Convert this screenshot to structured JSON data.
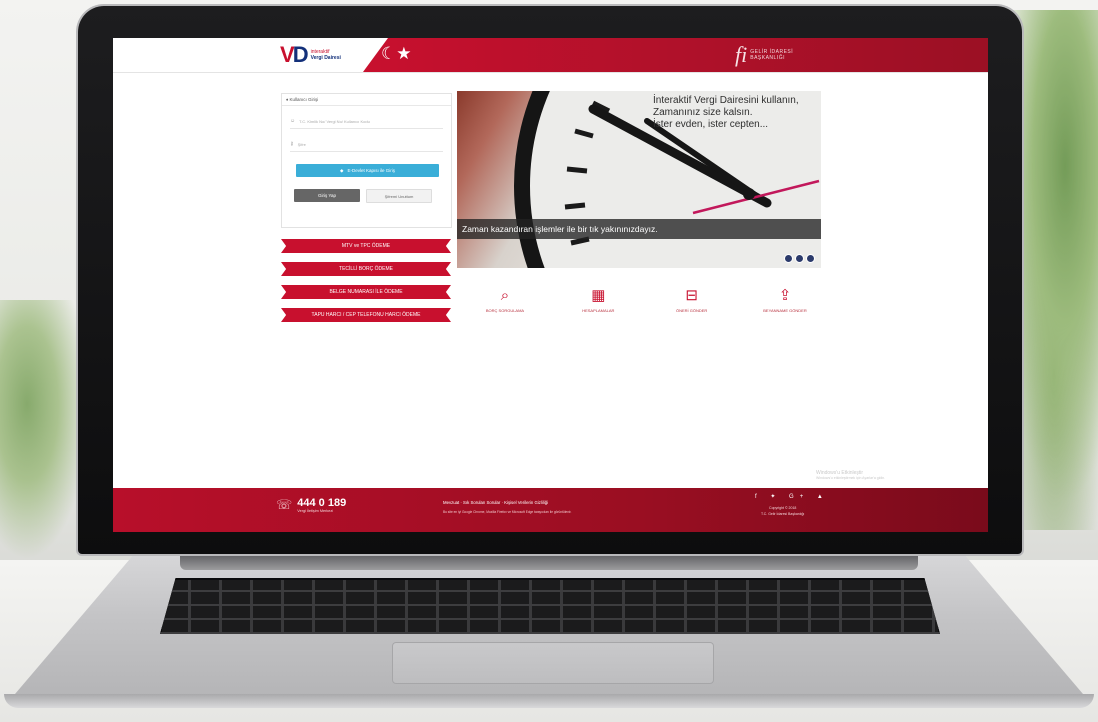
{
  "header": {
    "logo_letters_v": "V",
    "logo_letters_d": "D",
    "logo_line1": "interaktif",
    "logo_line2": "Vergi Dairesi",
    "flag_glyph": "☾★",
    "gib_mark": "fi",
    "gib_line1": "GELİR İDARESİ",
    "gib_line2": "BAŞKANLIĞI"
  },
  "login": {
    "title": "Kullanıcı Girişi",
    "user_placeholder": "T.C. Kimlik No/ Vergi No/ Kullanıcı Kodu",
    "password_placeholder": "Şifre",
    "edevlet_button": "E-Devlet Kapısı ile Giriş",
    "login_button": "Giriş Yap",
    "forgot_button": "Şifremi Unuttum"
  },
  "payments": [
    {
      "label": "MTV ve TPC ÖDEME"
    },
    {
      "label": "TECİLLİ BORÇ ÖDEME"
    },
    {
      "label": "BELGE NUMARASI İLE ÖDEME"
    },
    {
      "label": "TAPU HARCI / CEP TELEFONU HARCI ÖDEME"
    }
  ],
  "slider": {
    "quote_line1": "İnteraktif Vergi Dairesini kullanın,",
    "quote_line2": "Zamanınız size kalsın.",
    "quote_line3": "İster evden, ister cepten...",
    "caption": "Zaman kazandıran işlemler ile bir tık yakınınızdayız."
  },
  "quick_links": [
    {
      "label": "BORÇ SORGULAMA",
      "icon": "search-icon"
    },
    {
      "label": "HESAPLAMALAR",
      "icon": "calculator-icon"
    },
    {
      "label": "ÖNERİ GÖNDER",
      "icon": "inbox-icon"
    },
    {
      "label": "BEYANNAME GÖNDER",
      "icon": "upload-icon"
    }
  ],
  "watermark": {
    "line1": "Windows'u Etkinleştir",
    "line2": "Windows'u etkinleştirmek için Ayarlar'a gidin."
  },
  "footer": {
    "phone": "444 0 189",
    "phone_sub": "Vergi İletişim Merkezi",
    "links": "Mevzuat · Sık Sorulan Sorular · Kişisel Verilerin Gizliliği",
    "note": "Bu site en iyi Google Chrome, Mozilla Firefox ve Microsoft Edge tarayıcıları ile görüntülenir.",
    "social": "f  ✦  G+  ▲",
    "copyright_line1": "Copyright © 2018",
    "copyright_line2": "T.C. Gelir İdaresi Başkanlığı"
  },
  "colors": {
    "brand_red": "#c8102e",
    "brand_blue": "#13307a",
    "button_blue": "#3aaed8"
  }
}
